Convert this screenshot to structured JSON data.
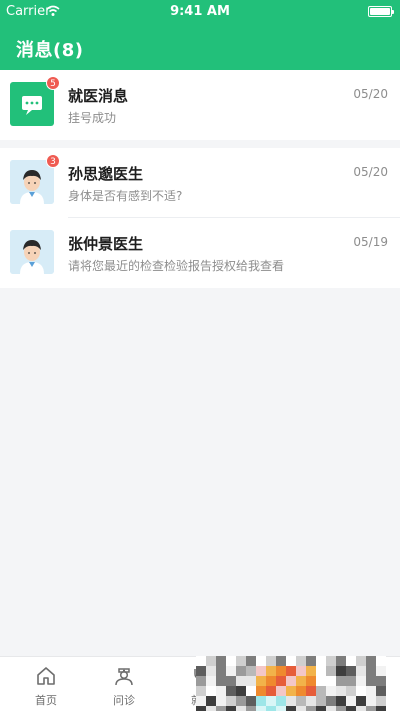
{
  "status": {
    "carrier": "Carrier",
    "time": "9:41 AM"
  },
  "header": {
    "title": "消息(8)"
  },
  "messages": [
    {
      "name": "就医消息",
      "preview": "挂号成功",
      "date": "05/20",
      "badge": "5",
      "avatar": "chat-icon"
    },
    {
      "name": "孙思邈医生",
      "preview": "身体是否有感到不适?",
      "date": "05/20",
      "badge": "3",
      "avatar": "doctor-avatar"
    },
    {
      "name": "张仲景医生",
      "preview": "请将您最近的检查检验报告授权给我查看",
      "date": "05/19",
      "badge": "",
      "avatar": "doctor-avatar"
    }
  ],
  "tabbar": {
    "tabs": [
      {
        "label": "首页",
        "icon": "home-icon"
      },
      {
        "label": "问诊",
        "icon": "doctor-icon"
      },
      {
        "label": "就诊",
        "icon": "clinic-icon"
      }
    ]
  },
  "colors": {
    "brand": "#22c07a",
    "badge": "#ef5b52"
  }
}
